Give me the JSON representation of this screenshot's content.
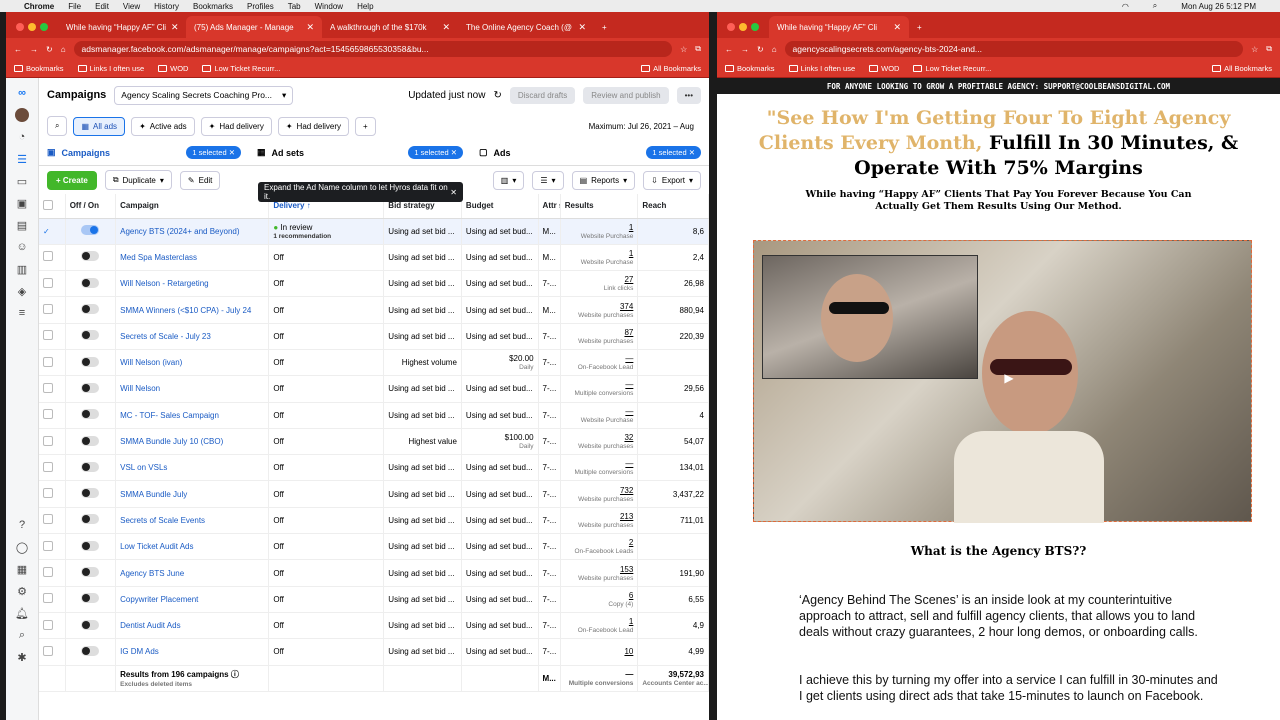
{
  "menubar": {
    "app": "Chrome",
    "items": [
      "File",
      "Edit",
      "View",
      "History",
      "Bookmarks",
      "Profiles",
      "Tab",
      "Window",
      "Help"
    ],
    "clock": "Mon Aug 26  5:12 PM"
  },
  "left_window": {
    "tabs": [
      "While having “Happy AF” Cli",
      "(75) Ads Manager - Manage",
      "A walkthrough of the $170k",
      "The Online Agency Coach (@"
    ],
    "url": "adsmanager.facebook.com/adsmanager/manage/campaigns?act=1545659865530358&bu...",
    "bookmarks": [
      "Bookmarks",
      "Links I often use",
      "WOD",
      "Low Ticket Recurr...",
      "All Bookmarks"
    ]
  },
  "ads": {
    "campaigns_title": "Campaigns",
    "account": "Agency Scaling Secrets Coaching Pro...",
    "updated": "Updated just now",
    "discard": "Discard drafts",
    "review": "Review and publish",
    "filters": [
      "All ads",
      "Active ads",
      "Had delivery",
      "Had delivery"
    ],
    "date": "Maximum: Jul 26, 2021 – Aug",
    "levels": {
      "campaigns": "Campaigns",
      "adsets": "Ad sets",
      "ads": "Ads",
      "selected": "1 selected"
    },
    "toolbar": {
      "create": "Create",
      "duplicate": "Duplicate",
      "edit": "Edit",
      "reports": "Reports",
      "export": "Export"
    },
    "tooltip": "Expand the Ad Name column to let Hyros data fit on it.",
    "columns": [
      "Off / On",
      "Campaign",
      "Delivery ↑",
      "Bid strategy",
      "Budget",
      "Attr set",
      "Results",
      "Reach"
    ],
    "rows": [
      {
        "name": "Agency BTS (2024+ and Beyond)",
        "delivery": "In review",
        "delivery_sub": "1 recommendation",
        "bid": "Using ad set bid ...",
        "budget": "Using ad set bud...",
        "attr": "M...",
        "result": "1",
        "result_sub": "Website Purchase",
        "reach": "8,6"
      },
      {
        "name": "Med Spa Masterclass",
        "delivery": "Off",
        "bid": "Using ad set bid ...",
        "budget": "Using ad set bud...",
        "attr": "M...",
        "result": "1",
        "result_sub": "Website Purchase",
        "reach": "2,4"
      },
      {
        "name": "Will Nelson - Retargeting",
        "delivery": "Off",
        "bid": "Using ad set bid ...",
        "budget": "Using ad set bud...",
        "attr": "7-...",
        "result": "27",
        "result_sub": "Link clicks",
        "reach": "26,98"
      },
      {
        "name": "SMMA Winners (<$10 CPA) - July 24",
        "delivery": "Off",
        "bid": "Using ad set bid ...",
        "budget": "Using ad set bud...",
        "attr": "M...",
        "result": "374",
        "result_sub": "Website purchases",
        "reach": "880,94"
      },
      {
        "name": "Secrets of Scale - July 23",
        "delivery": "Off",
        "bid": "Using ad set bid ...",
        "budget": "Using ad set bud...",
        "attr": "7-...",
        "result": "87",
        "result_sub": "Website purchases",
        "reach": "220,39"
      },
      {
        "name": "Will Nelson (ivan)",
        "delivery": "Off",
        "bid": "Highest volume",
        "budget": "$20.00",
        "budget_sub": "Daily",
        "attr": "7-...",
        "result": "—",
        "result_sub": "On-Facebook Lead",
        "reach": ""
      },
      {
        "name": "Will Nelson",
        "delivery": "Off",
        "bid": "Using ad set bid ...",
        "budget": "Using ad set bud...",
        "attr": "7-...",
        "result": "—",
        "result_sub": "Multiple conversions",
        "reach": "29,56"
      },
      {
        "name": "MC - TOF- Sales Campaign",
        "delivery": "Off",
        "bid": "Using ad set bid ...",
        "budget": "Using ad set bud...",
        "attr": "7-...",
        "result": "—",
        "result_sub": "Website Purchase",
        "reach": "4"
      },
      {
        "name": "SMMA Bundle July 10 (CBO)",
        "delivery": "Off",
        "bid": "Highest value",
        "budget": "$100.00",
        "budget_sub": "Daily",
        "attr": "7-...",
        "result": "32",
        "result_sub": "Website purchases",
        "reach": "54,07"
      },
      {
        "name": "VSL on VSLs",
        "delivery": "Off",
        "bid": "Using ad set bid ...",
        "budget": "Using ad set bud...",
        "attr": "7-...",
        "result": "—",
        "result_sub": "Multiple conversions",
        "reach": "134,01"
      },
      {
        "name": "SMMA Bundle July",
        "delivery": "Off",
        "bid": "Using ad set bid ...",
        "budget": "Using ad set bud...",
        "attr": "7-...",
        "result": "732",
        "result_sub": "Website purchases",
        "reach": "3,437,22"
      },
      {
        "name": "Secrets of Scale Events",
        "delivery": "Off",
        "bid": "Using ad set bid ...",
        "budget": "Using ad set bud...",
        "attr": "7-...",
        "result": "213",
        "result_sub": "Website purchases",
        "reach": "711,01"
      },
      {
        "name": "Low Ticket Audit Ads",
        "delivery": "Off",
        "bid": "Using ad set bid ...",
        "budget": "Using ad set bud...",
        "attr": "7-...",
        "result": "2",
        "result_sub": "On-Facebook Leads",
        "reach": ""
      },
      {
        "name": "Agency BTS June",
        "delivery": "Off",
        "bid": "Using ad set bid ...",
        "budget": "Using ad set bud...",
        "attr": "7-...",
        "result": "153",
        "result_sub": "Website purchases",
        "reach": "191,90"
      },
      {
        "name": "Copywriter Placement",
        "delivery": "Off",
        "bid": "Using ad set bid ...",
        "budget": "Using ad set bud...",
        "attr": "7-...",
        "result": "6",
        "result_sub": "Copy (4)",
        "reach": "6,55"
      },
      {
        "name": "Dentist Audit Ads",
        "delivery": "Off",
        "bid": "Using ad set bid ...",
        "budget": "Using ad set bud...",
        "attr": "7-...",
        "result": "1",
        "result_sub": "On-Facebook Lead",
        "reach": "4,9"
      },
      {
        "name": "IG DM Ads",
        "delivery": "Off",
        "bid": "Using ad set bid ...",
        "budget": "Using ad set bud...",
        "attr": "7-...",
        "result": "10",
        "result_sub": "",
        "reach": "4,99"
      }
    ],
    "footer": {
      "label": "Results from 196 campaigns",
      "sub": "Excludes deleted items",
      "attr": "M...",
      "result": "—",
      "result_sub": "Multiple conversions",
      "reach": "39,572,93",
      "reach_sub": "Accounts Center ac..."
    }
  },
  "right_window": {
    "tab": "While having “Happy AF” Cli",
    "url": "agencyscalingsecrets.com/agency-bts-2024-and...",
    "bookmarks": [
      "Bookmarks",
      "Links I often use",
      "WOD",
      "Low Ticket Recurr...",
      "All Bookmarks"
    ]
  },
  "landing": {
    "banner": "FOR ANYONE LOOKING TO GROW A PROFITABLE AGENCY: SUPPORT@COOLBEANSDIGITAL.COM",
    "headline_gold": "\"See How I'm Getting Four To Eight Agency Clients Every Month,",
    "headline_dark": " Fulfill In 30 Minutes, & Operate With 75% Margins",
    "subhead": "While having “Happy AF” Clients That Pay You Forever Because You Can Actually Get Them Results Using Our Method.",
    "what_is": "What is the Agency BTS??",
    "para1": "‘Agency Behind The Scenes’ is an inside look at my counterintuitive approach to attract, sell and fulfill agency clients, that allows you to land deals without crazy guarantees, 2 hour long demos, or onboarding calls.",
    "para2": "I achieve this by turning my offer into a service I can fulfill in 30-minutes and I get clients using direct ads that take 15-minutes to launch on Facebook."
  }
}
